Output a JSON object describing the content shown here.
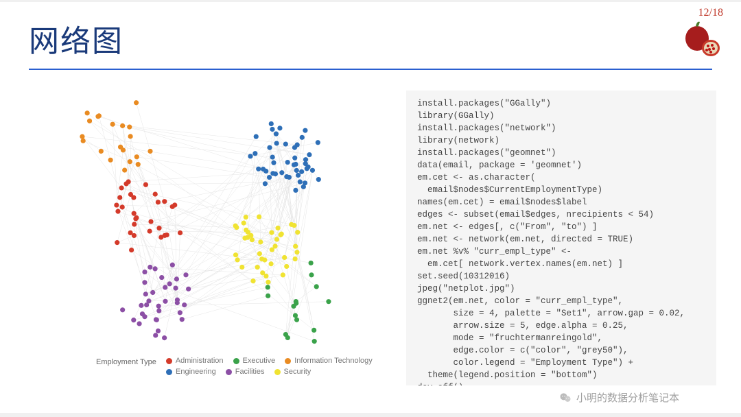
{
  "page": {
    "number": "12/18",
    "title": "网络图"
  },
  "chart_data": {
    "type": "network",
    "title": "",
    "legend_title": "Employment Type",
    "categories": [
      {
        "name": "Administration",
        "color": "#d43a2a",
        "approx_nodes": 30
      },
      {
        "name": "Executive",
        "color": "#3aa24a",
        "approx_nodes": 15
      },
      {
        "name": "Information Technology",
        "color": "#e98b22",
        "approx_nodes": 20
      },
      {
        "name": "Engineering",
        "color": "#2e6fb7",
        "approx_nodes": 45
      },
      {
        "name": "Facilities",
        "color": "#8c4fa5",
        "approx_nodes": 35
      },
      {
        "name": "Security",
        "color": "#f0e332",
        "approx_nodes": 40
      }
    ],
    "notes": "Force-directed (fruchtermanreingold) network of Enron email dataset; nodes colored by employment type; approximately 185 nodes total, directed grey edges with alpha 0.25."
  },
  "code": "install.packages(\"GGally\")\nlibrary(GGally)\ninstall.packages(\"network\")\nlibrary(network)\ninstall.packages(\"geomnet\")\ndata(email, package = 'geomnet')\nem.cet <- as.character(\n  email$nodes$CurrentEmploymentType)\nnames(em.cet) = email$nodes$label\nedges <- subset(email$edges, nrecipients < 54)\nem.net <- edges[, c(\"From\", \"to\") ]\nem.net <- network(em.net, directed = TRUE)\nem.net %v% \"curr_empl_type\" <-\n  em.cet[ network.vertex.names(em.net) ]\nset.seed(10312016)\njpeg(\"netplot.jpg\")\nggnet2(em.net, color = \"curr_empl_type\",\n       size = 4, palette = \"Set1\", arrow.gap = 0.02,\n       arrow.size = 5, edge.alpha = 0.25,\n       mode = \"fruchtermanreingold\",\n       edge.color = c(\"color\", \"grey50\"),\n       color.legend = \"Employment Type\") +\n  theme(legend.position = \"bottom\")\ndev.off()",
  "footer": {
    "label": "小明的数据分析笔记本"
  }
}
